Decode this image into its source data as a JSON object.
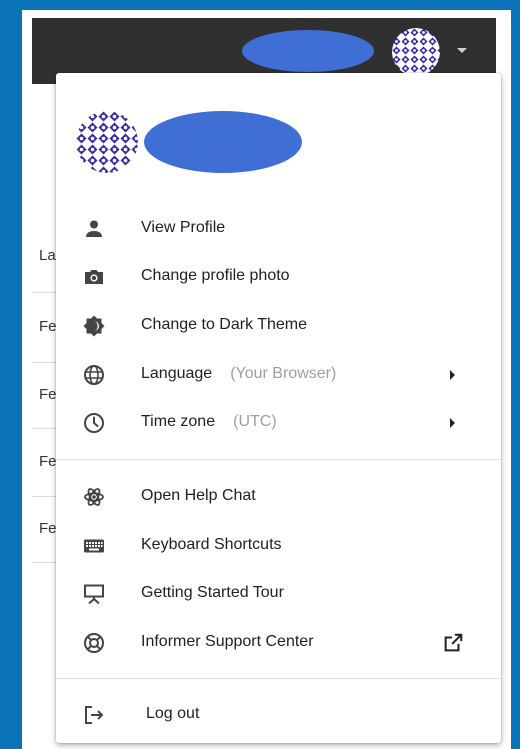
{
  "menu": {
    "items": [
      {
        "label": "View Profile"
      },
      {
        "label": "Change profile photo"
      },
      {
        "label": "Change to Dark Theme"
      },
      {
        "label": "Language",
        "sub": "(Your Browser)"
      },
      {
        "label": "Time zone",
        "sub": "(UTC)"
      }
    ],
    "help_items": [
      {
        "label": "Open Help Chat"
      },
      {
        "label": "Keyboard Shortcuts"
      },
      {
        "label": "Getting Started Tour"
      },
      {
        "label": "Informer Support Center"
      }
    ],
    "logout": {
      "label": "Log out"
    }
  },
  "background": {
    "rows": [
      "La",
      "Fe",
      "Fe",
      "Fe",
      "Fe"
    ]
  },
  "colors": {
    "frame": "#0b73b8",
    "topbar": "#303030",
    "redaction": "#3f6fd4",
    "avatar": "#3b2aa8"
  }
}
